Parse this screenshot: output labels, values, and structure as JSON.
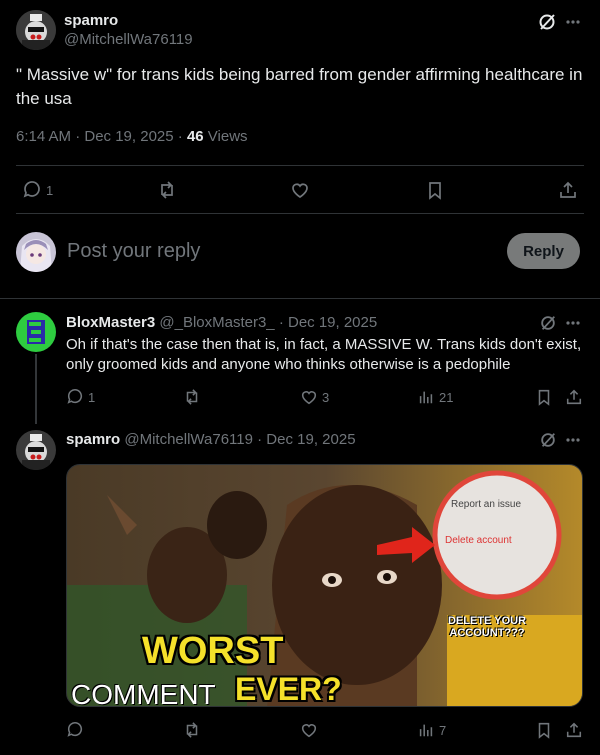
{
  "main_post": {
    "display_name": "spamro",
    "handle": "@MitchellWa76119",
    "text": "\" Massive w\" for trans kids being barred from gender affirming healthcare in the usa",
    "time": "6:14 AM · Dec 19, 2025 · ",
    "views_count": "46",
    "views_label": "Views",
    "reply_count": "1"
  },
  "reply_box": {
    "placeholder": "Post your reply",
    "button": "Reply"
  },
  "reply1": {
    "display_name": "BloxMaster3",
    "meta": "@_BloxMaster3_ · Dec 19, 2025",
    "text": "Oh if that's the case then that is, in fact, a MASSIVE W. Trans kids don't exist, only groomed kids and anyone who thinks otherwise is a pedophile",
    "replies": "1",
    "likes": "3",
    "views": "21"
  },
  "reply2": {
    "display_name": "spamro",
    "meta": "@MitchellWa76119 · Dec 19, 2025",
    "views": "7",
    "media": {
      "menu_item_1": "Report an issue",
      "menu_item_2": "Delete account",
      "caption_right": "DELETE YOUR ACCOUNT???",
      "caption_big": "WORST",
      "caption_small": "COMMENT",
      "caption_big2": "EVER?"
    }
  },
  "colors": {
    "background": "#000000",
    "text": "#e7e9ea",
    "muted": "#71767b",
    "divider": "#2f3336",
    "reply_button_bg": "#787a7a",
    "accent_green": "#2ecc40"
  }
}
